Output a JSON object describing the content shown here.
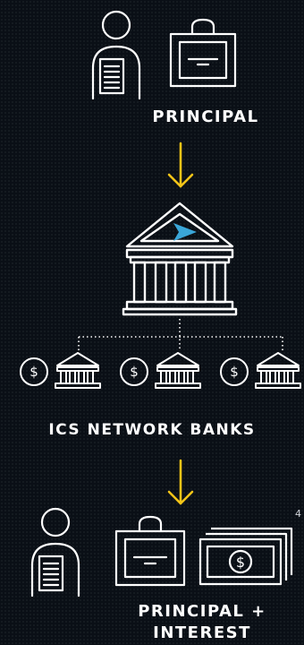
{
  "labels": {
    "principal": "PRINCIPAL",
    "network_banks": "ICS NETWORK BANKS",
    "principal_interest_line1": "PRINCIPAL +",
    "principal_interest_line2": "INTEREST",
    "footnote": "4"
  },
  "colors": {
    "background": "#0a0f16",
    "line": "#ffffff",
    "arrow": "#f5c518",
    "accent": "#3aa6d8"
  },
  "icons": {
    "depositor_top": "person-document-icon",
    "certificate_top": "certificate-icon",
    "arrow_top": "arrow-down-icon",
    "central_bank": "bank-icon",
    "network_banks": [
      "dollar-coin-bank-icon",
      "dollar-coin-bank-icon",
      "dollar-coin-bank-icon"
    ],
    "arrow_bottom": "arrow-down-icon",
    "depositor_bottom": "person-document-icon",
    "certificate_bottom": "certificate-icon",
    "cash": "cash-stack-icon"
  }
}
